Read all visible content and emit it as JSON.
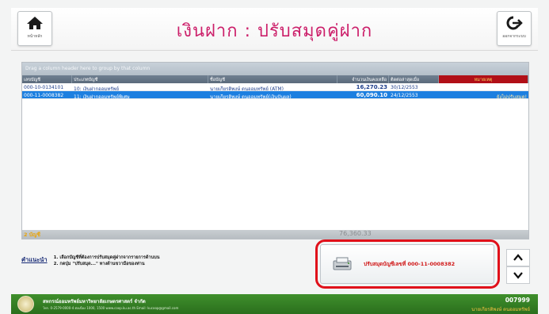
{
  "header": {
    "title": "เงินฝาก : ปรับสมุดคู่ฝาก",
    "home_label": "หน้าหลัก",
    "exit_label": "ออกจากระบบ"
  },
  "grid": {
    "group_hint": "Drag a column header here to group by that column",
    "columns": [
      "เลขบัญชี",
      "ประเภทบัญชี",
      "ชื่อบัญชี",
      "จำนวนเงินคงเหลือ",
      "ติดต่อล่าสุดเมื่อ",
      "หมายเหตุ"
    ],
    "rows": [
      {
        "account_no": "000-10-0134101",
        "type": "10: เงินฝากออมทรัพย์",
        "name": "นายเกียรติพงษ์  ตนออมทรัพย์ (ATM)",
        "balance": "16,270.23",
        "last_contact": "30/12/2553",
        "note": "",
        "selected": false
      },
      {
        "account_no": "000-11-0008382",
        "type": "11: เงินฝากออมทรัพย์พิเศษ",
        "name": "นายเกียรติพงษ์  ตนออมทรัพย์(เงินปันผล)",
        "balance": "60,090.10",
        "last_contact": "24/12/2553",
        "note": "ยังไม่ปรับสมุด!",
        "selected": true
      }
    ],
    "footer_count": "2 บัญชี",
    "footer_total": "76,360.33"
  },
  "instructions": {
    "title": "คำแนะนำ",
    "line1": "1.  เลือกบัญชีที่ต้องการปรับสมุดคู่ฝากจากรายการด้านบน",
    "line2": "2.  กดปุ่ม \"ปรับสมุด...\" ทางด้านขวามือของท่าน"
  },
  "action": {
    "label": "ปรับสมุดบัญชีเลขที่ 000-11-0008382"
  },
  "statusbar": {
    "org": "สหกรณ์ออมทรัพย์มหาวิทยาลัยเกษตรศาสตร์ จำกัด",
    "contact": "โทร. 0-2579-0000-4 ต่อเนื่อง 1000, 1500  www.coop.ku.ac.th   Email: kucoop@gmail.com",
    "code": "007999",
    "user": "นายเกียรติพงษ์  ตนออมทรัพย์"
  },
  "icons": {
    "home": "home-icon",
    "exit": "logout-icon",
    "printer": "passbook-printer-icon",
    "up": "chevron-up-icon",
    "down": "chevron-down-icon"
  },
  "colors": {
    "title": "#cc1f6a",
    "selection": "#1c7fe0",
    "highlight": "#e0101a",
    "statusbar": "#2b6f1d"
  }
}
